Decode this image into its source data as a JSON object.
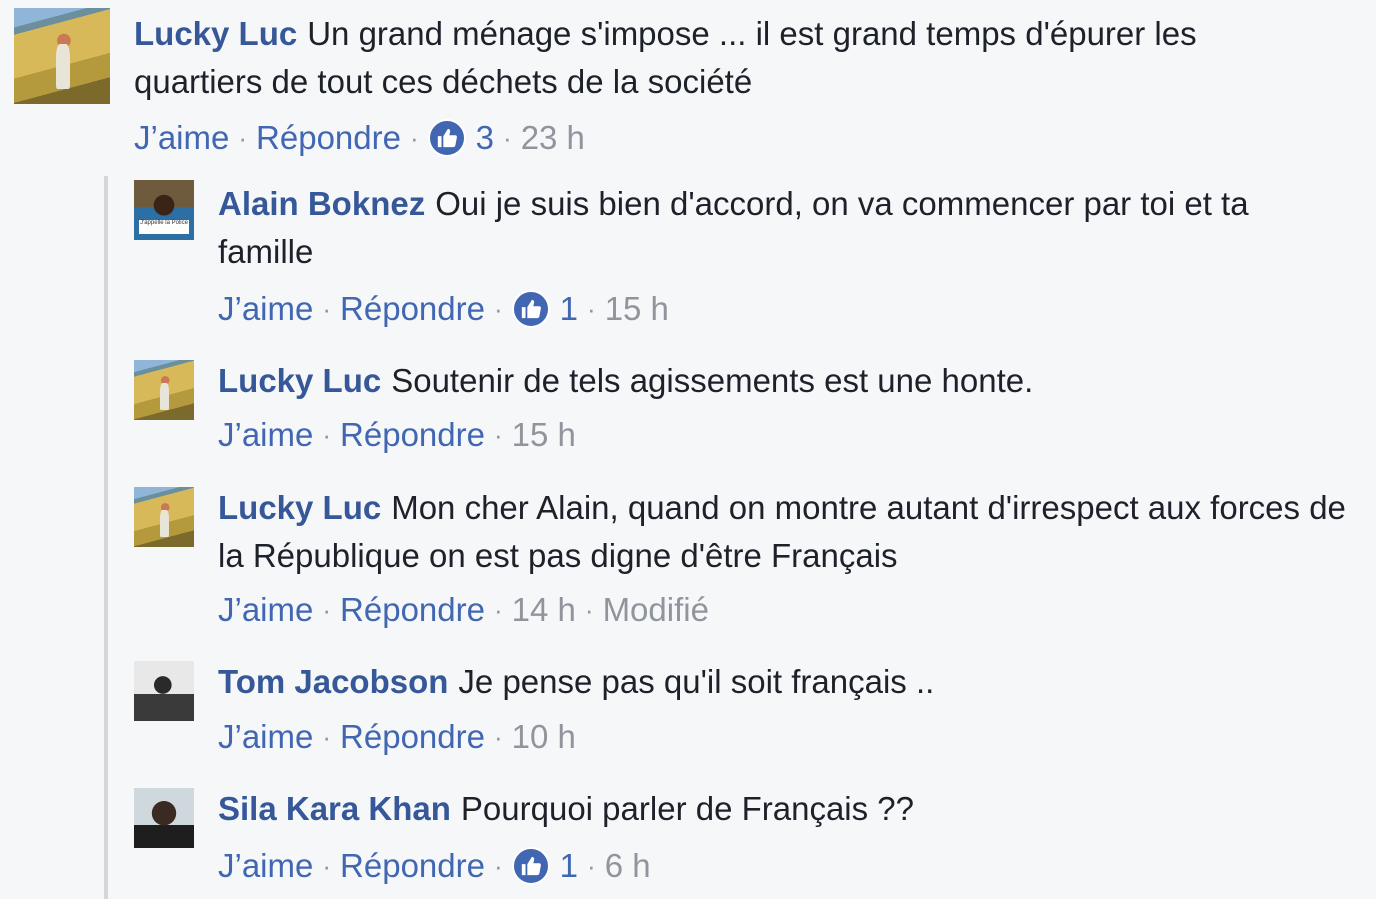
{
  "actions": {
    "like": "J’aime",
    "reply": "Répondre",
    "sep": "·"
  },
  "comments": [
    {
      "author": "Lucky Luc",
      "text": "Un grand ménage s'impose ... il est grand temps d'épurer les quartiers de tout ces déchets de la société",
      "likes": "3",
      "time": "23 h",
      "edited": ""
    },
    {
      "author": "Alain Boknez",
      "text": "Oui je suis bien d'accord, on va commencer par toi et ta famille",
      "likes": "1",
      "time": "15 h",
      "edited": "",
      "avatar_caption": "J'appelle la Police"
    },
    {
      "author": "Lucky Luc",
      "text": "Soutenir de tels agissements est une honte.",
      "likes": "",
      "time": "15 h",
      "edited": ""
    },
    {
      "author": "Lucky Luc",
      "text": "Mon cher Alain, quand on montre autant d'irrespect aux forces de la République on est pas digne d'être Français",
      "likes": "",
      "time": "14 h",
      "edited": "Modifié"
    },
    {
      "author": "Tom Jacobson",
      "text": "Je pense pas qu'il soit français ..",
      "likes": "",
      "time": "10 h",
      "edited": ""
    },
    {
      "author": "Sila Kara Khan",
      "text": "Pourquoi parler de Français ??",
      "likes": "1",
      "time": "6 h",
      "edited": ""
    }
  ],
  "colors": {
    "author": "#365899",
    "link": "#4267b2",
    "meta": "#90949c",
    "background": "#f6f7f9"
  }
}
